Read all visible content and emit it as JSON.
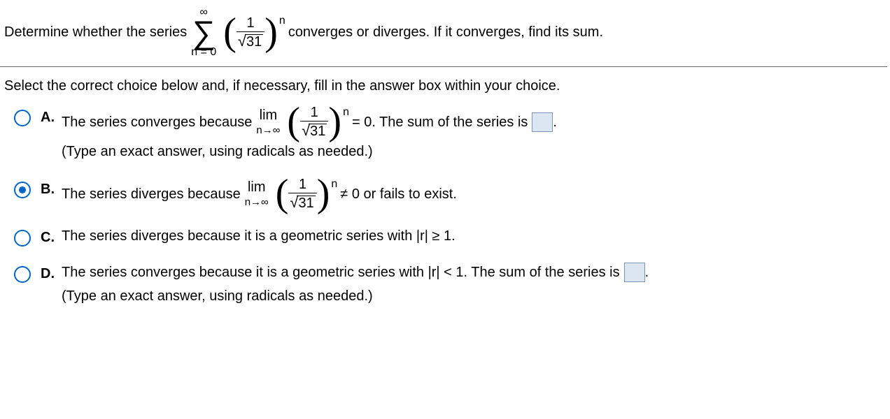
{
  "question": {
    "lead_in": "Determine whether the series",
    "tail": " converges or diverges. If it converges, find its sum.",
    "sum_top": "∞",
    "sum_bot": "n = 0",
    "frac_num": "1",
    "sqrt_arg": "31",
    "exp": "n"
  },
  "prompt": "Select the correct choice below and, if necessary, fill in the answer box within your choice.",
  "limit_common": {
    "lim": "lim",
    "to": "n→∞",
    "frac_num": "1",
    "sqrt_arg": "31",
    "exp": "n"
  },
  "choices": {
    "A": {
      "label": "A.",
      "pre": "The series converges because ",
      "post_eq": " = 0. The sum of the series is ",
      "period": ".",
      "note": "(Type an exact answer, using radicals as needed.)",
      "selected": false
    },
    "B": {
      "label": "B.",
      "pre": "The series diverges because ",
      "post_eq": " ≠ 0 or fails to exist.",
      "selected": true
    },
    "C": {
      "label": "C.",
      "text": "The series diverges because it is a geometric series with |r| ≥ 1.",
      "selected": false
    },
    "D": {
      "label": "D.",
      "pre": "The series converges because it is a geometric series with |r| < 1. The sum of the series is ",
      "period": ".",
      "note": "(Type an exact answer, using radicals as needed.)",
      "selected": false
    }
  }
}
